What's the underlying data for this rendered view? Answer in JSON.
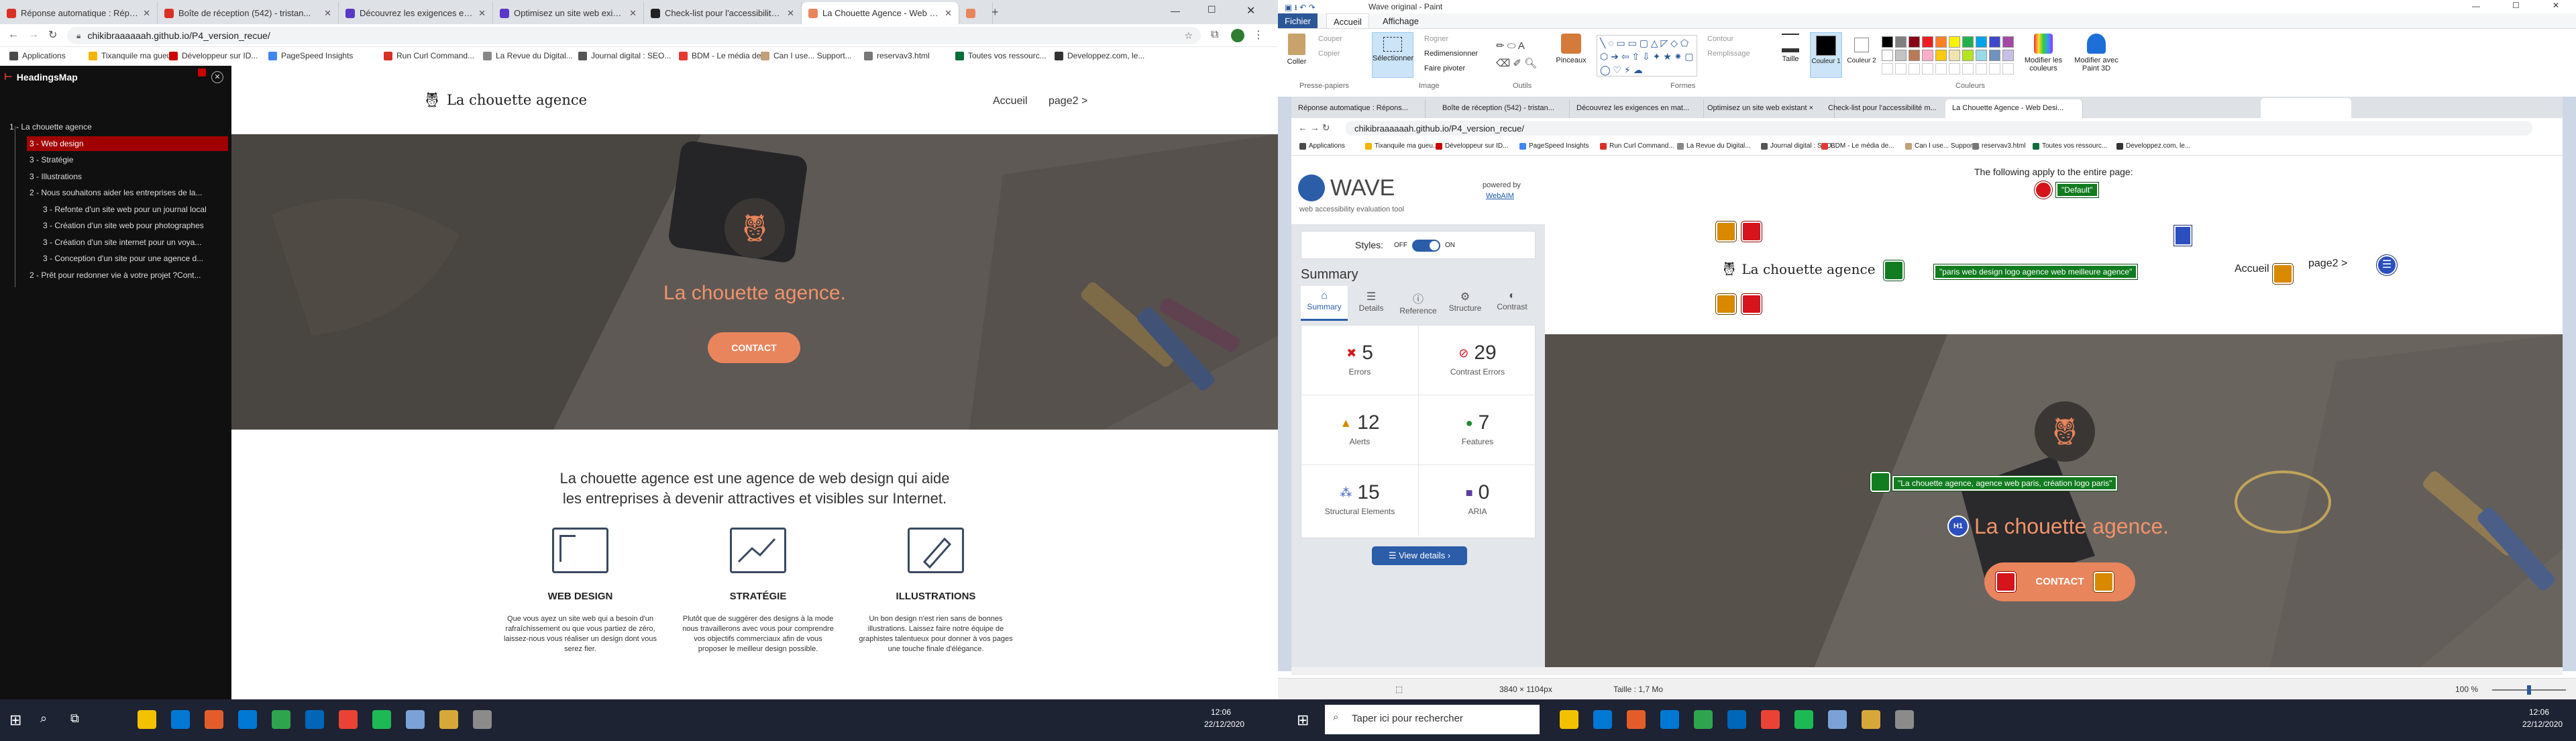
{
  "left_browser": {
    "tabs": [
      {
        "label": "Réponse automatique : Réponse...",
        "color": "#d93025"
      },
      {
        "label": "Boîte de réception (542) - tristan...",
        "color": "#d93025"
      },
      {
        "label": "Découvrez les exigences en mati...",
        "color": "#5a38c6"
      },
      {
        "label": "Optimisez un site web existant ×",
        "color": "#5a38c6"
      },
      {
        "label": "Check-list pour l'accessibilité m...",
        "color": "#222222"
      },
      {
        "label": "La Chouette Agence - Web Desi...",
        "color": "#e9855c"
      },
      {
        "label": "",
        "color": "#e9855c"
      }
    ],
    "url": "chikibraaaaaah.github.io/P4_version_recue/",
    "bookmarks": [
      {
        "label": "Applications",
        "color": "#4a4a4a"
      },
      {
        "label": "Tixanquile ma gueu...",
        "color": "#f4b400"
      },
      {
        "label": "Développeur sur ID...",
        "color": "#cc0000"
      },
      {
        "label": "PageSpeed Insights",
        "color": "#4285f4"
      },
      {
        "label": "Run Curl Command...",
        "color": "#d93025"
      },
      {
        "label": "La Revue du Digital...",
        "color": "#888888"
      },
      {
        "label": "Journal digital : SEO...",
        "color": "#555555"
      },
      {
        "label": "BDM - Le média de...",
        "color": "#e53935"
      },
      {
        "label": "Can I use... Support...",
        "color": "#c2a078"
      },
      {
        "label": "reservav3.html",
        "color": "#777777"
      },
      {
        "label": "Toutes vos ressourc...",
        "color": "#0b6b3a"
      },
      {
        "label": "Developpez.com, le...",
        "color": "#333333"
      }
    ]
  },
  "headingsmap": {
    "title": "HeadingsMap",
    "items": [
      {
        "text": "1 - La chouette agence",
        "level": 1,
        "selected": false
      },
      {
        "text": "3 - Web design",
        "level": 2,
        "selected": true
      },
      {
        "text": "3 - Stratégie",
        "level": 2,
        "selected": false
      },
      {
        "text": "3 - Illustrations",
        "level": 2,
        "selected": false
      },
      {
        "text": "2 - Nous souhaitons aider les entreprises de la...",
        "level": 2,
        "selected": false
      },
      {
        "text": "3 - Refonte d'un site web pour un journal local",
        "level": 3,
        "selected": false
      },
      {
        "text": "3 - Création d'un site web pour photographes",
        "level": 3,
        "selected": false
      },
      {
        "text": "3 - Création d'un site internet pour un voya...",
        "level": 3,
        "selected": false
      },
      {
        "text": "3 - Conception d'un site pour une agence d...",
        "level": 3,
        "selected": false
      },
      {
        "text": "2 - Prêt pour redonner vie à votre projet ?Cont...",
        "level": 2,
        "selected": false
      }
    ]
  },
  "site": {
    "logo": "La chouette agence",
    "nav": [
      "Accueil",
      "page2 >"
    ],
    "hero_title": "La chouette agence.",
    "hero_button": "CONTACT",
    "intro": [
      "La chouette agence est une agence de web design qui aide",
      "les entreprises à devenir attractives et visibles sur Internet."
    ],
    "services": [
      {
        "icon": "web-design-icon",
        "title": "WEB DESIGN",
        "text": [
          "Que vous ayez un site web qui a besoin d'un",
          "rafraîchissement ou que vous partiez de zéro,",
          "laissez-nous vous réaliser un design dont vous",
          "serez fier."
        ]
      },
      {
        "icon": "strategy-icon",
        "title": "STRATÉGIE",
        "text": [
          "Plutôt que de suggérer des designs à la mode",
          "nous travaillerons avec vous pour comprendre",
          "vos objectifs commerciaux afin de vous",
          "proposer le meilleur design possible."
        ]
      },
      {
        "icon": "illustration-icon",
        "title": "ILLUSTRATIONS",
        "text": [
          "Un bon design n'est rien sans de bonnes",
          "illustrations. Laissez faire notre équipe de",
          "graphistes talentueux pour donner à vos pages",
          "une touche finale d'élégance."
        ]
      }
    ]
  },
  "paint": {
    "title": "Wave original - Paint",
    "tabs": [
      "Fichier",
      "Accueil",
      "Affichage"
    ],
    "clipboard": {
      "paste": "Coller",
      "cut": "Couper",
      "copy": "Copier",
      "label": "Presse-papiers"
    },
    "image": {
      "select": "Sélectionner",
      "crop": "Rogner",
      "resize": "Redimensionner",
      "rotate": "Faire pivoter",
      "label": "Image"
    },
    "tools": {
      "label": "Outils",
      "brushes": "Pinceaux"
    },
    "shapes": {
      "label": "Formes",
      "outline": "Contour",
      "fill": "Remplissage"
    },
    "size": "Taille",
    "color1": "Couleur 1",
    "color2": "Couleur 2",
    "colors_label": "Couleurs",
    "edit_colors": "Modifier les couleurs",
    "paint3d": "Modifier avec Paint 3D",
    "palette": [
      "#000000",
      "#7f7f7f",
      "#880015",
      "#ed1c24",
      "#ff7f27",
      "#fff200",
      "#22b14c",
      "#00a2e8",
      "#3f48cc",
      "#a349a4",
      "#ffffff",
      "#c3c3c3",
      "#b97a57",
      "#ffaec9",
      "#ffc90e",
      "#efe4b0",
      "#b5e61d",
      "#99d9ea",
      "#7092be",
      "#c8bfe7"
    ],
    "status": {
      "dims": "3840 × 1104px",
      "size": "Taille : 1,7 Mo",
      "zoom": "100 %"
    }
  },
  "inner_browser": {
    "url": "chikibraaaaaah.github.io/P4_version_recue/",
    "tabs": [
      "Réponse automatique : Répons...",
      "Boîte de réception (542) - tristan...",
      "Découvrez les exigences en mat...",
      "Optimisez un site web existant ×",
      "Check-list pour l'accessibilité m...",
      "La Chouette Agence - Web Desi..."
    ]
  },
  "wave": {
    "title": "WAVE",
    "subtitle": "web accessibility evaluation tool",
    "powered": "powered by",
    "webaim": "WebAIM",
    "styles": "Styles:",
    "off": "OFF",
    "on": "ON",
    "summary": "Summary",
    "tabs": [
      "Summary",
      "Details",
      "Reference",
      "Structure",
      "Contrast"
    ],
    "stats": [
      {
        "value": "5",
        "label": "Errors",
        "color": "#d5141b"
      },
      {
        "value": "29",
        "label": "Contrast Errors",
        "color": "#d5141b"
      },
      {
        "value": "12",
        "label": "Alerts",
        "color": "#d88900"
      },
      {
        "value": "7",
        "label": "Features",
        "color": "#1e8a2e"
      },
      {
        "value": "15",
        "label": "Structural Elements",
        "color": "#3b5bbf"
      },
      {
        "value": "0",
        "label": "ARIA",
        "color": "#5a3d9e"
      }
    ],
    "view_details": "View details ›",
    "entire_page": "The following apply to the entire page:",
    "default_tag": "\"Default\"",
    "logo_alt": "\"paris web design logo agence web meilleure agence\"",
    "hero_alt": "\"La chouette agence, agence web paris, création logo paris\"",
    "h1": "H1"
  },
  "right_taskbar": {
    "search": "Taper ici pour rechercher",
    "time": "12:06",
    "date": "22/12/2020"
  },
  "left_taskbar": {
    "time": "12:06",
    "date": "22/12/2020"
  }
}
